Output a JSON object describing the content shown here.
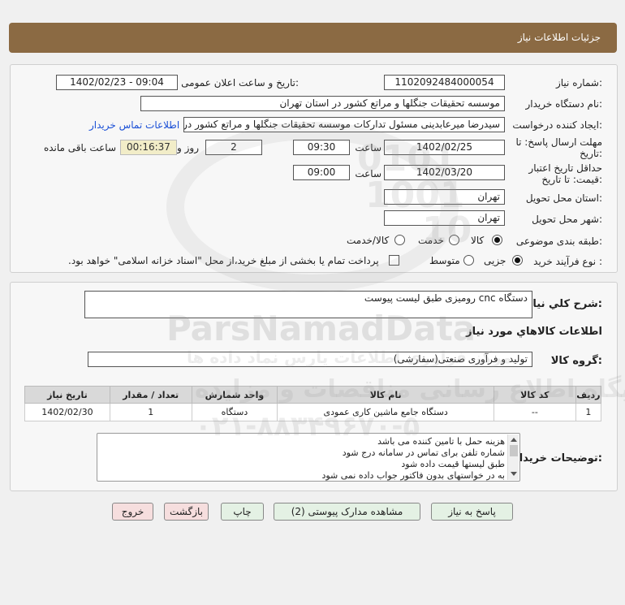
{
  "header": {
    "title": "جزئیات اطلاعات نیاز"
  },
  "fields": {
    "need_number_label": "شماره نیاز:",
    "need_number": "1102092484000054",
    "announce_label": "تاریخ و ساعت اعلان عمومی:",
    "announce_value": "1402/02/23 - 09:04",
    "buyer_label": "نام دستگاه خریدار:",
    "buyer_value": "موسسه تحقیقات جنگلها و مراتع کشور در استان تهران",
    "creator_label": "ایجاد کننده درخواست:",
    "creator_value": "سیدرضا میرعابدینی مسئول تدارکات موسسه تحقیقات جنگلها و مراتع کشور در",
    "contact_link": "اطلاعات تماس خریدار",
    "deadline_label_1": "مهلت ارسال پاسخ: تا",
    "deadline_label_2": "تاریخ:",
    "deadline_date": "1402/02/25",
    "time_label": "ساعت",
    "deadline_time": "09:30",
    "days_value": "2",
    "days_label": "روز و",
    "remaining_time": "00:16:37",
    "remaining_label": "ساعت باقی مانده",
    "validity_label_1": "حداقل تاریخ اعتبار",
    "validity_label_2": "قیمت: تا تاریخ:",
    "validity_date": "1402/03/20",
    "validity_time": "09:00",
    "province_label": "استان محل تحویل:",
    "province_value": "تهران",
    "city_label": "شهر محل تحویل:",
    "city_value": "تهران",
    "category_label": "طبقه بندی موضوعی:",
    "category_options": [
      "کالا",
      "خدمت",
      "کالا/خدمت"
    ],
    "process_label": "نوع فرآیند خرید :",
    "process_options": [
      "جزیی",
      "متوسط"
    ],
    "payment_note": "پرداخت تمام یا بخشی از مبلغ خرید،از محل \"اسناد خزانه اسلامی\" خواهد بود."
  },
  "summary": {
    "label": "شرح کلي نياز:",
    "value": "دستگاه cnc رومیزی طبق لیست پیوست",
    "goods_info_title": "اطلاعات کالاهاي مورد نياز",
    "group_label": "گروه کالا:",
    "group_value": "تولید و فرآوری صنعتی(سفارشی)"
  },
  "table": {
    "headers": [
      "ردیف",
      "کد کالا",
      "نام کالا",
      "واحد شمارش",
      "تعداد / مقدار",
      "تاریخ نیاز"
    ],
    "rows": [
      [
        "1",
        "--",
        "دستگاه جامع ماشین کاری عمودی",
        "دستگاه",
        "1",
        "1402/02/30"
      ]
    ]
  },
  "notes": {
    "label": "توضیحات خریدار:",
    "lines": [
      "هزینه حمل با تامین کننده می باشد",
      "شماره تلفن برای تماس در سامانه درج شود",
      "طبق لیستها قیمت داده شود",
      "به در خواستهای بدون فاکتور جواب داده نمی شود"
    ]
  },
  "buttons": {
    "reply": "پاسخ به نیاز",
    "attachments": "مشاهده مدارک پیوستی (2)",
    "print": "چاپ",
    "back": "بازگشت",
    "exit": "خروج"
  },
  "watermark": {
    "brand": "ParsNamadData",
    "persian": "مرکز فراوری اطلاعات پارس نماد داده ها",
    "portal": "پایگاه اطلاع رسانی مناقصات و مزایده",
    "phone": "۰۲۱-۸۸۳۴۹۶۷۰-۵",
    "code_1": "0101",
    "code_2": "1001",
    "code_3": "10"
  },
  "colors": {
    "header_bg": "#8b6a43",
    "link": "#1a4fd6",
    "button_green": "#e4f1e4",
    "button_pink": "#f6dede",
    "remaining_bg": "#f2edc8"
  }
}
